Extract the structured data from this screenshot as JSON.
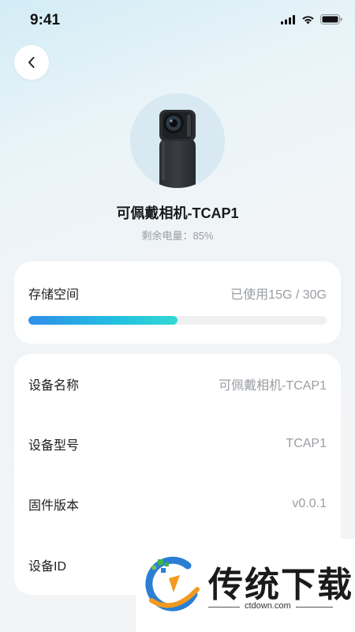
{
  "status_bar": {
    "time": "9:41"
  },
  "device": {
    "name": "可佩戴相机-TCAP1",
    "battery_text": "剩余电量：85%",
    "battery_level": 0.85
  },
  "storage": {
    "title": "存储空间",
    "usage_text": "已使用15G / 30G",
    "used_fraction": 0.5
  },
  "info": [
    {
      "label": "设备名称",
      "value": "可佩戴相机-TCAP1"
    },
    {
      "label": "设备型号",
      "value": "TCAP1"
    },
    {
      "label": "固件版本",
      "value": "v0.0.1"
    },
    {
      "label": "设备ID",
      "value": ""
    }
  ],
  "watermark": {
    "title": "传统下载",
    "url": "ctdown.com"
  },
  "colors": {
    "progress_start": "#2f8ee9",
    "progress_end": "#33d8d2",
    "background_tint": "#d3ecf6"
  }
}
